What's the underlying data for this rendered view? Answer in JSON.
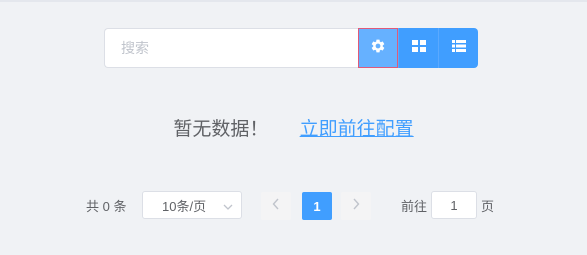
{
  "search": {
    "placeholder": "搜索",
    "value": ""
  },
  "toolbar": {
    "settings_icon": "gear-icon",
    "grid_icon": "grid-view-icon",
    "list_icon": "list-view-icon"
  },
  "empty_state": {
    "message": "暂无数据！",
    "link_label": "立即前往配置"
  },
  "pagination": {
    "total_label": "共 0 条",
    "page_size_label": "10条/页",
    "current_page": "1",
    "goto_label": "前往",
    "goto_value": "1",
    "page_unit_label": "页"
  },
  "colors": {
    "primary": "#409eff",
    "settings_bg": "#66b1ff",
    "focus_border": "#e05a7a"
  }
}
